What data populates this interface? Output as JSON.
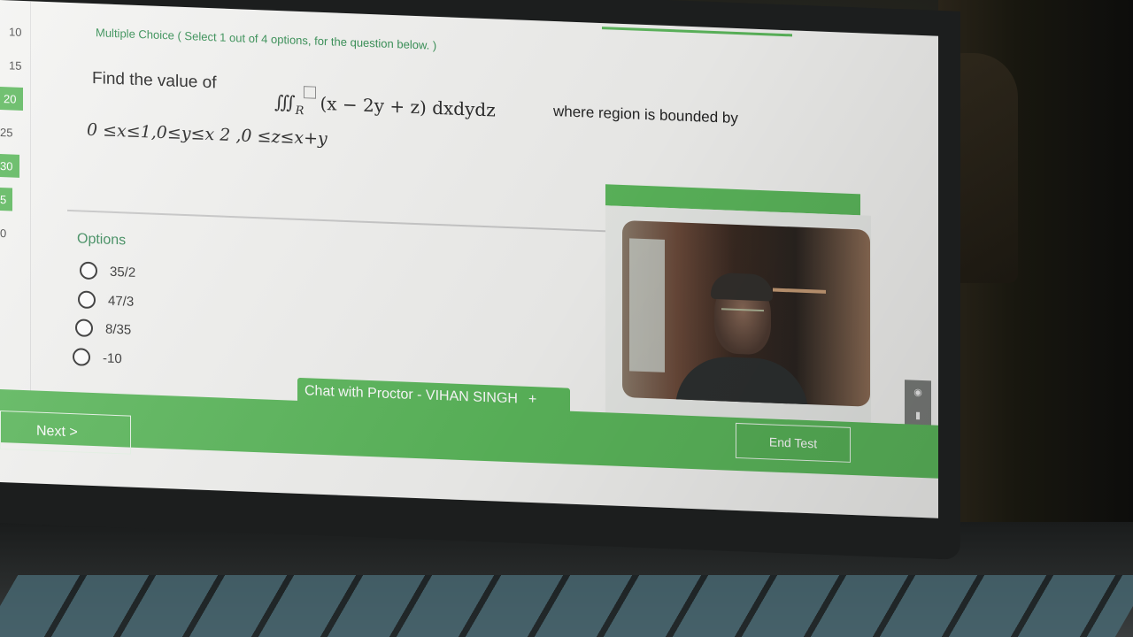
{
  "question_numbers": [
    "10",
    "15",
    "20",
    "25",
    "30",
    "5",
    "0"
  ],
  "question": {
    "type_label": "Multiple Choice ( Select 1 out of 4 options, for the question below. )",
    "prompt": "Find the value of",
    "integral_symbol": "∭",
    "integral_region": "R",
    "integrand": "(x − 2y + z) dxdydz",
    "region_text": "where region is bounded by",
    "bounds": "0 ≤x≤1,0≤y≤x 2 ,0 ≤z≤x+y"
  },
  "options": {
    "label": "Options",
    "items": [
      "35/2",
      "47/3",
      "8/35",
      "-10"
    ]
  },
  "proctor": {
    "chat_label": "Chat with Proctor - VIHAN SINGH",
    "chat_plus": "+"
  },
  "footer": {
    "next_label": "Next >",
    "end_label": "End Test"
  },
  "icons": {
    "camera": "camera-icon",
    "video": "video-icon",
    "screen": "screen-icon",
    "settings": "gear-icon"
  },
  "colors": {
    "accent_green": "#5cb85c",
    "label_green": "#2e8b4e",
    "screen_bg": "#f3f3f1"
  }
}
